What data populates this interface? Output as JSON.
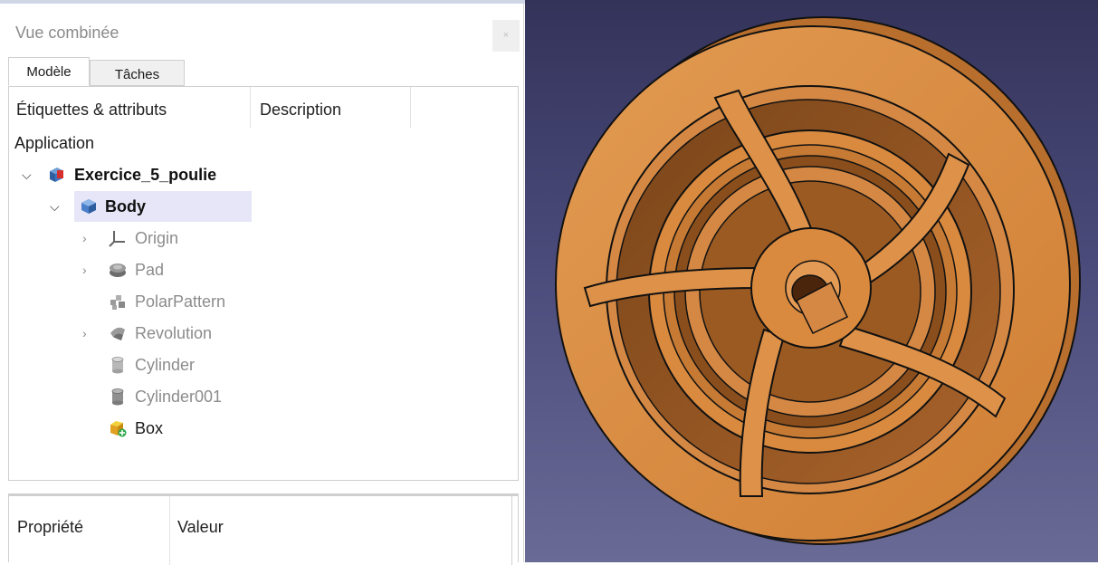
{
  "combo": {
    "title": "Vue combinée",
    "close_label": "×",
    "tabs": [
      {
        "label": "Modèle",
        "active": true
      },
      {
        "label": "Tâches",
        "active": false
      }
    ],
    "tree": {
      "columns": [
        "Étiquettes & attributs",
        "Description"
      ],
      "root_label": "Application",
      "items": [
        {
          "label": "Exercice_5_poulie",
          "icon": "document-icon",
          "expanded": true
        },
        {
          "label": "Body",
          "icon": "body-icon",
          "expanded": true,
          "selected": true
        },
        {
          "label": "Origin",
          "icon": "origin-icon",
          "expandable": true
        },
        {
          "label": "Pad",
          "icon": "pad-icon",
          "expandable": true
        },
        {
          "label": "PolarPattern",
          "icon": "polar-pattern-icon",
          "expandable": false
        },
        {
          "label": "Revolution",
          "icon": "revolution-icon",
          "expandable": true
        },
        {
          "label": "Cylinder",
          "icon": "cylinder-icon",
          "expandable": false
        },
        {
          "label": "Cylinder001",
          "icon": "cylinder-icon",
          "expandable": false
        },
        {
          "label": "Box",
          "icon": "box-icon",
          "expandable": false
        }
      ]
    },
    "properties": {
      "columns": [
        "Propriété",
        "Valeur"
      ]
    }
  },
  "view3d": {
    "background_top": "#33335a",
    "background_bottom": "#6a6a96",
    "part_color": "#d98a3e"
  }
}
